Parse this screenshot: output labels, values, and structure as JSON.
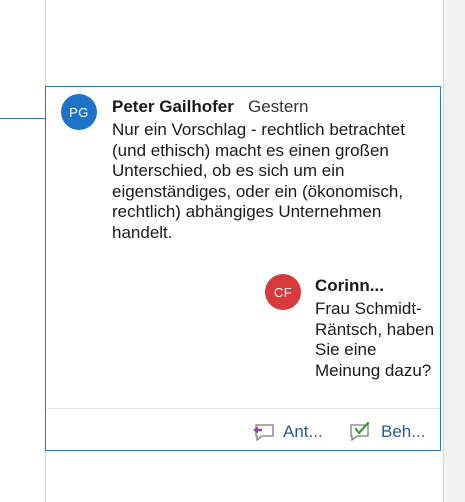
{
  "comment": {
    "avatar_initials": "PG",
    "author": "Peter Gailhofer",
    "timestamp": "Gestern",
    "text": "Nur ein Vorschlag - rechtlich betrachtet (und ethisch) macht es einen großen Unterschied, ob es sich um ein eigenständiges, oder ein (ökonomisch, rechtlich) abhängiges Unternehmen handelt."
  },
  "reply": {
    "avatar_initials": "CF",
    "author": "Corinn...",
    "text": "Frau Schmidt-Räntsch, haben Sie eine Meinung dazu?"
  },
  "actions": {
    "reply_label": "Ant...",
    "resolve_label": "Beh..."
  },
  "icons": {
    "reply": "reply-comment-icon",
    "resolve": "resolve-comment-icon"
  },
  "colors": {
    "accent": "#2b79c2",
    "avatar_pg": "#1e73c9",
    "avatar_cf": "#d73a3d",
    "link": "#2b5797"
  }
}
